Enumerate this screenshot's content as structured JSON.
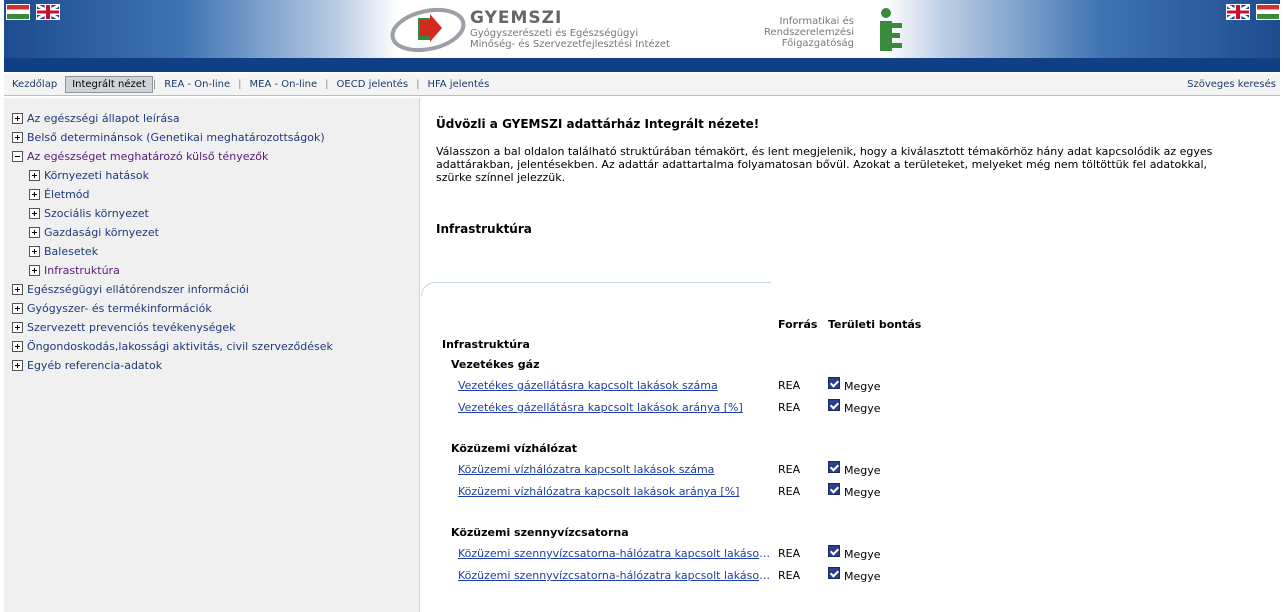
{
  "header": {
    "logo_title": "GYEMSZI",
    "logo_sub1": "Gyógyszerészeti és Egészségügyi",
    "logo_sub2": "Minőség- és Szervezetfejlesztési Intézet",
    "right_line1": "Informatikai és",
    "right_line2": "Rendszerelemzési",
    "right_line3": "Főigazgatóság"
  },
  "nav": {
    "items": [
      "Kezdőlap",
      "Integrált nézet",
      "REA - On-line",
      "MEA - On-line",
      "OECD jelentés",
      "HFA jelentés"
    ],
    "search": "Szöveges keresés"
  },
  "sidebar": {
    "items": [
      {
        "label": "Az egészségi állapot leírása"
      },
      {
        "label": "Belső determinánsok (Genetikai meghatározottságok)"
      },
      {
        "label": "Az egészséget meghatározó külső tényezők"
      },
      {
        "label": "Környezeti hatások"
      },
      {
        "label": "Életmód"
      },
      {
        "label": "Szociális környezet"
      },
      {
        "label": "Gazdasági környezet"
      },
      {
        "label": "Balesetek"
      },
      {
        "label": "Infrastruktúra"
      },
      {
        "label": "Egészségügyi ellátórendszer információi"
      },
      {
        "label": "Gyógyszer- és termékinformációk"
      },
      {
        "label": "Szervezett prevenciós tevékenységek"
      },
      {
        "label": "Öngondoskodás,lakossági aktivitás, civil szerveződések"
      },
      {
        "label": "Egyéb referencia-adatok"
      }
    ]
  },
  "main": {
    "welcome_title": "Üdvözli a GYEMSZI adattárház Integrált nézete!",
    "welcome_text": "Válasszon a bal oldalon található struktúrában témakört, és lent megjelenik, hogy a kiválasztott témakörhöz hány adat kapcsolódik az egyes adattárakban, jelentésekben. Az adattár adattartalma folyamatosan bővül. Azokat a területeket, melyeket még nem töltöttük fel adatokkal, szürke színnel jelezzük.",
    "section_title": "Infrastruktúra",
    "col_forras": "Forrás",
    "col_teruleti": "Területi bontás",
    "table_title": "Infrastruktúra",
    "groups": [
      {
        "title": "Vezetékes gáz",
        "rows": [
          {
            "label": "Vezetékes gázellátásra kapcsolt lakások száma",
            "source": "REA",
            "region": "Megye"
          },
          {
            "label": "Vezetékes gázellátásra kapcsolt lakások aránya [%]",
            "source": "REA",
            "region": "Megye"
          }
        ]
      },
      {
        "title": "Közüzemi vízhálózat",
        "rows": [
          {
            "label": "Közüzemi vízhálózatra kapcsolt lakások száma",
            "source": "REA",
            "region": "Megye"
          },
          {
            "label": "Közüzemi vízhálózatra kapcsolt lakások aránya [%]",
            "source": "REA",
            "region": "Megye"
          }
        ]
      },
      {
        "title": "Közüzemi szennyvízcsatorna",
        "rows": [
          {
            "label": "Közüzemi szennyvízcsatorna-hálózatra kapcsolt lakások száma",
            "source": "REA",
            "region": "Megye"
          },
          {
            "label": "Közüzemi szennyvízcsatorna-hálózatra kapcsolt lakások aránya [%]",
            "source": "REA",
            "region": "Megye"
          }
        ]
      }
    ]
  }
}
